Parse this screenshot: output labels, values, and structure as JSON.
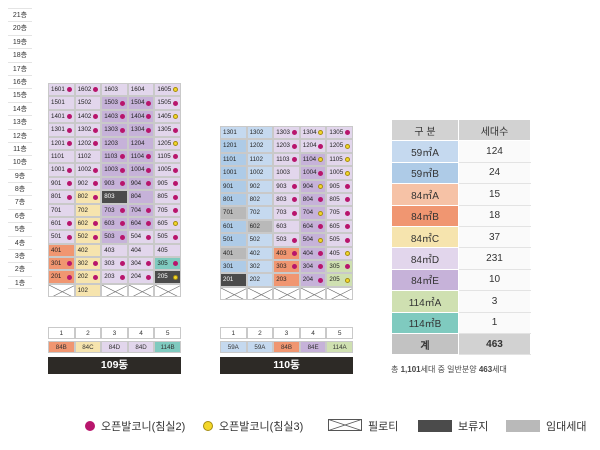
{
  "floors": [
    "21층",
    "20층",
    "19층",
    "18층",
    "17층",
    "16층",
    "15층",
    "14층",
    "13층",
    "12층",
    "11층",
    "10층",
    "9층",
    "8층",
    "7층",
    "6층",
    "5층",
    "4층",
    "3층",
    "2층",
    "1층"
  ],
  "colors": {
    "59A": "#c5d9ef",
    "59B": "#aecbe7",
    "84A": "#f6c2a6",
    "84B": "#f09671",
    "84C": "#f6e4ae",
    "84D": "#e2d6ec",
    "84E": "#c6b2d9",
    "114A": "#cfe0b1",
    "114B": "#7fcabf",
    "rental": "#b9b9b9",
    "reserved": "#4b4b4b",
    "pilotis": "#ffffff",
    "magenta_dot": "#b8156c",
    "yellow_dot": "#f4d72a"
  },
  "buildings": [
    {
      "name": "109동",
      "lines": [
        "1",
        "2",
        "3",
        "4",
        "5"
      ],
      "line_types": [
        "84B",
        "84C",
        "84D",
        "84D",
        "114B"
      ],
      "rows": [
        {
          "floor": 16,
          "units": [
            {
              "no": "1601",
              "t": "84D",
              "d": "m"
            },
            {
              "no": "1602",
              "t": "84D",
              "d": "m"
            },
            {
              "no": "1603",
              "t": "84D",
              "d": ""
            },
            {
              "no": "1604",
              "t": "84D",
              "d": ""
            },
            {
              "no": "1605",
              "t": "84D",
              "d": "y"
            }
          ]
        },
        {
          "floor": 15,
          "units": [
            {
              "no": "1501",
              "t": "84D",
              "d": ""
            },
            {
              "no": "1502",
              "t": "84D",
              "d": ""
            },
            {
              "no": "1503",
              "t": "84E",
              "d": "m"
            },
            {
              "no": "1504",
              "t": "84E",
              "d": "m"
            },
            {
              "no": "1505",
              "t": "84D",
              "d": "m"
            }
          ]
        },
        {
          "floor": 14,
          "units": [
            {
              "no": "1401",
              "t": "84D",
              "d": "m"
            },
            {
              "no": "1402",
              "t": "84D",
              "d": "m"
            },
            {
              "no": "1403",
              "t": "84E",
              "d": "m"
            },
            {
              "no": "1404",
              "t": "84E",
              "d": "m"
            },
            {
              "no": "1405",
              "t": "84D",
              "d": "y"
            }
          ]
        },
        {
          "floor": 13,
          "units": [
            {
              "no": "1301",
              "t": "84D",
              "d": "m"
            },
            {
              "no": "1302",
              "t": "84D",
              "d": "m"
            },
            {
              "no": "1303",
              "t": "84E",
              "d": "m"
            },
            {
              "no": "1304",
              "t": "84E",
              "d": "m"
            },
            {
              "no": "1305",
              "t": "84D",
              "d": "m"
            }
          ]
        },
        {
          "floor": 12,
          "units": [
            {
              "no": "1201",
              "t": "84D",
              "d": "m"
            },
            {
              "no": "1202",
              "t": "84D",
              "d": "m"
            },
            {
              "no": "1203",
              "t": "84E",
              "d": ""
            },
            {
              "no": "1204",
              "t": "84E",
              "d": ""
            },
            {
              "no": "1205",
              "t": "84D",
              "d": "y"
            }
          ]
        },
        {
          "floor": 11,
          "units": [
            {
              "no": "1101",
              "t": "84D",
              "d": ""
            },
            {
              "no": "1102",
              "t": "84D",
              "d": ""
            },
            {
              "no": "1103",
              "t": "84E",
              "d": "m"
            },
            {
              "no": "1104",
              "t": "84E",
              "d": "m"
            },
            {
              "no": "1105",
              "t": "84D",
              "d": "m"
            }
          ]
        },
        {
          "floor": 10,
          "units": [
            {
              "no": "1001",
              "t": "84D",
              "d": "m"
            },
            {
              "no": "1002",
              "t": "84D",
              "d": "m"
            },
            {
              "no": "1003",
              "t": "84E",
              "d": "m"
            },
            {
              "no": "1004",
              "t": "84E",
              "d": "m"
            },
            {
              "no": "1005",
              "t": "84D",
              "d": "m"
            }
          ]
        },
        {
          "floor": 9,
          "units": [
            {
              "no": "901",
              "t": "84D",
              "d": "m"
            },
            {
              "no": "902",
              "t": "84D",
              "d": "m"
            },
            {
              "no": "903",
              "t": "84E",
              "d": "m"
            },
            {
              "no": "904",
              "t": "84E",
              "d": "m"
            },
            {
              "no": "905",
              "t": "84D",
              "d": "m"
            }
          ]
        },
        {
          "floor": 8,
          "units": [
            {
              "no": "801",
              "t": "84D",
              "d": "m"
            },
            {
              "no": "802",
              "t": "84C",
              "d": "m"
            },
            {
              "no": "803",
              "t": "reserved",
              "d": ""
            },
            {
              "no": "804",
              "t": "84E",
              "d": ""
            },
            {
              "no": "805",
              "t": "84D",
              "d": "m"
            }
          ]
        },
        {
          "floor": 7,
          "units": [
            {
              "no": "701",
              "t": "84D",
              "d": ""
            },
            {
              "no": "702",
              "t": "84C",
              "d": ""
            },
            {
              "no": "703",
              "t": "84E",
              "d": "m"
            },
            {
              "no": "704",
              "t": "84E",
              "d": "m"
            },
            {
              "no": "705",
              "t": "84D",
              "d": "m"
            }
          ]
        },
        {
          "floor": 6,
          "units": [
            {
              "no": "601",
              "t": "84D",
              "d": "m"
            },
            {
              "no": "602",
              "t": "84C",
              "d": "m"
            },
            {
              "no": "603",
              "t": "84E",
              "d": "m"
            },
            {
              "no": "604",
              "t": "84E",
              "d": "m"
            },
            {
              "no": "605",
              "t": "84D",
              "d": "y"
            }
          ]
        },
        {
          "floor": 5,
          "units": [
            {
              "no": "501",
              "t": "84D",
              "d": "m"
            },
            {
              "no": "502",
              "t": "84C",
              "d": "m"
            },
            {
              "no": "503",
              "t": "84E",
              "d": "m"
            },
            {
              "no": "504",
              "t": "84D",
              "d": "m"
            },
            {
              "no": "505",
              "t": "84D",
              "d": "m"
            }
          ]
        },
        {
          "floor": 4,
          "units": [
            {
              "no": "401",
              "t": "84B",
              "d": ""
            },
            {
              "no": "402",
              "t": "84C",
              "d": ""
            },
            {
              "no": "403",
              "t": "84D",
              "d": ""
            },
            {
              "no": "404",
              "t": "84D",
              "d": ""
            },
            {
              "no": "405",
              "t": "84D",
              "d": ""
            }
          ]
        },
        {
          "floor": 3,
          "units": [
            {
              "no": "301",
              "t": "84B",
              "d": "m"
            },
            {
              "no": "302",
              "t": "84C",
              "d": "m"
            },
            {
              "no": "303",
              "t": "84D",
              "d": "m"
            },
            {
              "no": "304",
              "t": "84D",
              "d": "m"
            },
            {
              "no": "305",
              "t": "114B",
              "d": "m"
            }
          ]
        },
        {
          "floor": 2,
          "units": [
            {
              "no": "201",
              "t": "84B",
              "d": "m"
            },
            {
              "no": "202",
              "t": "84C",
              "d": "m"
            },
            {
              "no": "203",
              "t": "84D",
              "d": "m"
            },
            {
              "no": "204",
              "t": "84D",
              "d": "m"
            },
            {
              "no": "205",
              "t": "reserved",
              "d": "y"
            }
          ]
        },
        {
          "floor": 1,
          "units": [
            {
              "no": "",
              "t": "pilotis",
              "d": ""
            },
            {
              "no": "102",
              "t": "84C",
              "d": ""
            },
            {
              "no": "",
              "t": "pilotis",
              "d": ""
            },
            {
              "no": "",
              "t": "pilotis",
              "d": ""
            },
            {
              "no": "",
              "t": "pilotis",
              "d": ""
            }
          ]
        }
      ]
    },
    {
      "name": "110동",
      "lines": [
        "1",
        "2",
        "3",
        "4",
        "5"
      ],
      "line_types": [
        "59A",
        "59A",
        "84B",
        "84E",
        "114A"
      ],
      "rows": [
        {
          "floor": 13,
          "units": [
            {
              "no": "1301",
              "t": "59A",
              "d": ""
            },
            {
              "no": "1302",
              "t": "59A",
              "d": ""
            },
            {
              "no": "1303",
              "t": "84D",
              "d": "m"
            },
            {
              "no": "1304",
              "t": "84D",
              "d": "y"
            },
            {
              "no": "1305",
              "t": "84D",
              "d": "m"
            }
          ]
        },
        {
          "floor": 12,
          "units": [
            {
              "no": "1201",
              "t": "59B",
              "d": ""
            },
            {
              "no": "1202",
              "t": "59A",
              "d": ""
            },
            {
              "no": "1203",
              "t": "84D",
              "d": "m"
            },
            {
              "no": "1204",
              "t": "84D",
              "d": "m"
            },
            {
              "no": "1205",
              "t": "84D",
              "d": "y"
            }
          ]
        },
        {
          "floor": 11,
          "units": [
            {
              "no": "1101",
              "t": "59B",
              "d": ""
            },
            {
              "no": "1102",
              "t": "59A",
              "d": ""
            },
            {
              "no": "1103",
              "t": "84D",
              "d": "m"
            },
            {
              "no": "1104",
              "t": "84E",
              "d": "y"
            },
            {
              "no": "1105",
              "t": "84D",
              "d": "y"
            }
          ]
        },
        {
          "floor": 10,
          "units": [
            {
              "no": "1001",
              "t": "59B",
              "d": ""
            },
            {
              "no": "1002",
              "t": "59A",
              "d": ""
            },
            {
              "no": "1003",
              "t": "84D",
              "d": ""
            },
            {
              "no": "1004",
              "t": "84E",
              "d": "m"
            },
            {
              "no": "1005",
              "t": "84D",
              "d": "y"
            }
          ]
        },
        {
          "floor": 9,
          "units": [
            {
              "no": "901",
              "t": "59B",
              "d": ""
            },
            {
              "no": "902",
              "t": "59A",
              "d": ""
            },
            {
              "no": "903",
              "t": "84D",
              "d": "m"
            },
            {
              "no": "904",
              "t": "84E",
              "d": "y"
            },
            {
              "no": "905",
              "t": "84D",
              "d": "m"
            }
          ]
        },
        {
          "floor": 8,
          "units": [
            {
              "no": "801",
              "t": "59B",
              "d": ""
            },
            {
              "no": "802",
              "t": "59A",
              "d": ""
            },
            {
              "no": "803",
              "t": "84D",
              "d": "m"
            },
            {
              "no": "804",
              "t": "84E",
              "d": "m"
            },
            {
              "no": "805",
              "t": "84D",
              "d": "m"
            }
          ]
        },
        {
          "floor": 7,
          "units": [
            {
              "no": "701",
              "t": "rental",
              "d": ""
            },
            {
              "no": "702",
              "t": "59A",
              "d": ""
            },
            {
              "no": "703",
              "t": "84D",
              "d": "m"
            },
            {
              "no": "704",
              "t": "84E",
              "d": "y"
            },
            {
              "no": "705",
              "t": "84D",
              "d": "m"
            }
          ]
        },
        {
          "floor": 6,
          "units": [
            {
              "no": "601",
              "t": "59B",
              "d": ""
            },
            {
              "no": "602",
              "t": "rental",
              "d": ""
            },
            {
              "no": "603",
              "t": "84D",
              "d": ""
            },
            {
              "no": "604",
              "t": "84E",
              "d": "m"
            },
            {
              "no": "605",
              "t": "84D",
              "d": "m"
            }
          ]
        },
        {
          "floor": 5,
          "units": [
            {
              "no": "501",
              "t": "59B",
              "d": ""
            },
            {
              "no": "502",
              "t": "59A",
              "d": ""
            },
            {
              "no": "503",
              "t": "84D",
              "d": "m"
            },
            {
              "no": "504",
              "t": "84E",
              "d": "y"
            },
            {
              "no": "505",
              "t": "84D",
              "d": "m"
            }
          ]
        },
        {
          "floor": 4,
          "units": [
            {
              "no": "401",
              "t": "rental",
              "d": ""
            },
            {
              "no": "402",
              "t": "59A",
              "d": ""
            },
            {
              "no": "403",
              "t": "84B",
              "d": "m"
            },
            {
              "no": "404",
              "t": "84E",
              "d": "m"
            },
            {
              "no": "405",
              "t": "84D",
              "d": "y"
            }
          ]
        },
        {
          "floor": 3,
          "units": [
            {
              "no": "301",
              "t": "59B",
              "d": ""
            },
            {
              "no": "302",
              "t": "59A",
              "d": ""
            },
            {
              "no": "303",
              "t": "84B",
              "d": "m"
            },
            {
              "no": "304",
              "t": "84E",
              "d": "m"
            },
            {
              "no": "305",
              "t": "114A",
              "d": "m"
            }
          ]
        },
        {
          "floor": 2,
          "units": [
            {
              "no": "201",
              "t": "reserved",
              "d": ""
            },
            {
              "no": "202",
              "t": "59A",
              "d": ""
            },
            {
              "no": "203",
              "t": "84B",
              "d": ""
            },
            {
              "no": "204",
              "t": "84E",
              "d": "m"
            },
            {
              "no": "205",
              "t": "114A",
              "d": "y"
            }
          ]
        },
        {
          "floor": 1,
          "units": [
            {
              "no": "",
              "t": "pilotis",
              "d": ""
            },
            {
              "no": "",
              "t": "pilotis",
              "d": ""
            },
            {
              "no": "",
              "t": "pilotis",
              "d": ""
            },
            {
              "no": "",
              "t": "pilotis",
              "d": ""
            },
            {
              "no": "",
              "t": "pilotis",
              "d": ""
            }
          ]
        }
      ]
    }
  ],
  "type_table": {
    "header_type": "구 분",
    "header_count": "세대수",
    "rows": [
      {
        "type": "59㎡A",
        "count": "124",
        "color_key": "59A"
      },
      {
        "type": "59㎡B",
        "count": "24",
        "color_key": "59B"
      },
      {
        "type": "84㎡A",
        "count": "15",
        "color_key": "84A"
      },
      {
        "type": "84㎡B",
        "count": "18",
        "color_key": "84B"
      },
      {
        "type": "84㎡C",
        "count": "37",
        "color_key": "84C"
      },
      {
        "type": "84㎡D",
        "count": "231",
        "color_key": "84D"
      },
      {
        "type": "84㎡E",
        "count": "10",
        "color_key": "84E"
      },
      {
        "type": "114㎡A",
        "count": "3",
        "color_key": "114A"
      },
      {
        "type": "114㎡B",
        "count": "1",
        "color_key": "114B"
      }
    ],
    "total_label": "계",
    "total_count": "463"
  },
  "summary": {
    "prefix": "총 ",
    "total": "1,101",
    "middle": "세대 중 일반분양 ",
    "general": "463",
    "suffix": "세대"
  },
  "legend": {
    "open_balcony_2": "오픈발코니(침실2)",
    "open_balcony_3": "오픈발코니(침실3)",
    "pilotis": "필로티",
    "reserved": "보류지",
    "rental": "임대세대"
  }
}
